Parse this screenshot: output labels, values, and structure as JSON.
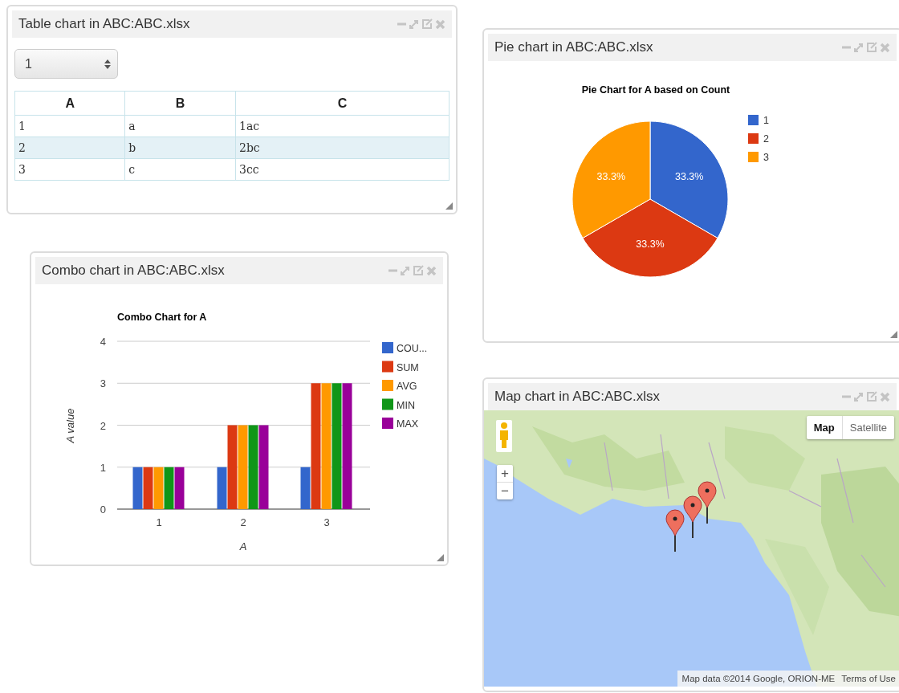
{
  "widgets": [
    {
      "kind": "table",
      "title": "Table chart in ABC:ABC.xlsx",
      "select": {
        "value": "1"
      },
      "table": {
        "columns": [
          "A",
          "B",
          "C"
        ],
        "rows": [
          {
            "cells": [
              "1",
              "a",
              "1ac"
            ],
            "selected": false
          },
          {
            "cells": [
              "2",
              "b",
              "2bc"
            ],
            "selected": true
          },
          {
            "cells": [
              "3",
              "c",
              "3cc"
            ],
            "selected": false
          }
        ]
      }
    },
    {
      "kind": "combo",
      "title": "Combo chart in ABC:ABC.xlsx",
      "chart_data": {
        "type": "bar",
        "title": "Combo Chart for A",
        "xlabel": "A",
        "ylabel": "A value",
        "categories": [
          "1",
          "2",
          "3"
        ],
        "ylim": [
          0,
          4
        ],
        "yticks": [
          0,
          1,
          2,
          3,
          4
        ],
        "grid": true,
        "legend": true,
        "series": [
          {
            "name": "COU...",
            "color": "#3366cc",
            "values": [
              1,
              1,
              1
            ]
          },
          {
            "name": "SUM",
            "color": "#dc3912",
            "values": [
              1,
              2,
              3
            ]
          },
          {
            "name": "AVG",
            "color": "#ff9900",
            "values": [
              1,
              2,
              3
            ]
          },
          {
            "name": "MIN",
            "color": "#109618",
            "values": [
              1,
              2,
              3
            ]
          },
          {
            "name": "MAX",
            "color": "#990099",
            "values": [
              1,
              2,
              3
            ]
          }
        ]
      }
    },
    {
      "kind": "pie",
      "title": "Pie chart in ABC:ABC.xlsx",
      "chart_data": {
        "type": "pie",
        "title": "Pie Chart for A based on Count",
        "categories": [
          "1",
          "2",
          "3"
        ],
        "values": [
          33.3,
          33.3,
          33.3
        ],
        "legend": true,
        "colors": [
          "#3366cc",
          "#dc3912",
          "#ff9900"
        ],
        "value_labels": [
          "33.3%",
          "33.3%",
          "33.3%"
        ]
      }
    },
    {
      "kind": "map",
      "title": "Map chart in ABC:ABC.xlsx",
      "map": {
        "kind": "picture"
      },
      "map_type_buttons": [
        {
          "label": "Map",
          "selected": true
        },
        {
          "label": "Satellite",
          "selected": false
        }
      ],
      "zoom_buttons": [
        "+",
        "−"
      ],
      "pins": [
        {
          "kind": "pin"
        },
        {
          "kind": "pin"
        },
        {
          "kind": "pin"
        }
      ],
      "attribution": "Map data ©2014 Google, ORION-ME",
      "terms_link": "Terms of Use"
    }
  ]
}
